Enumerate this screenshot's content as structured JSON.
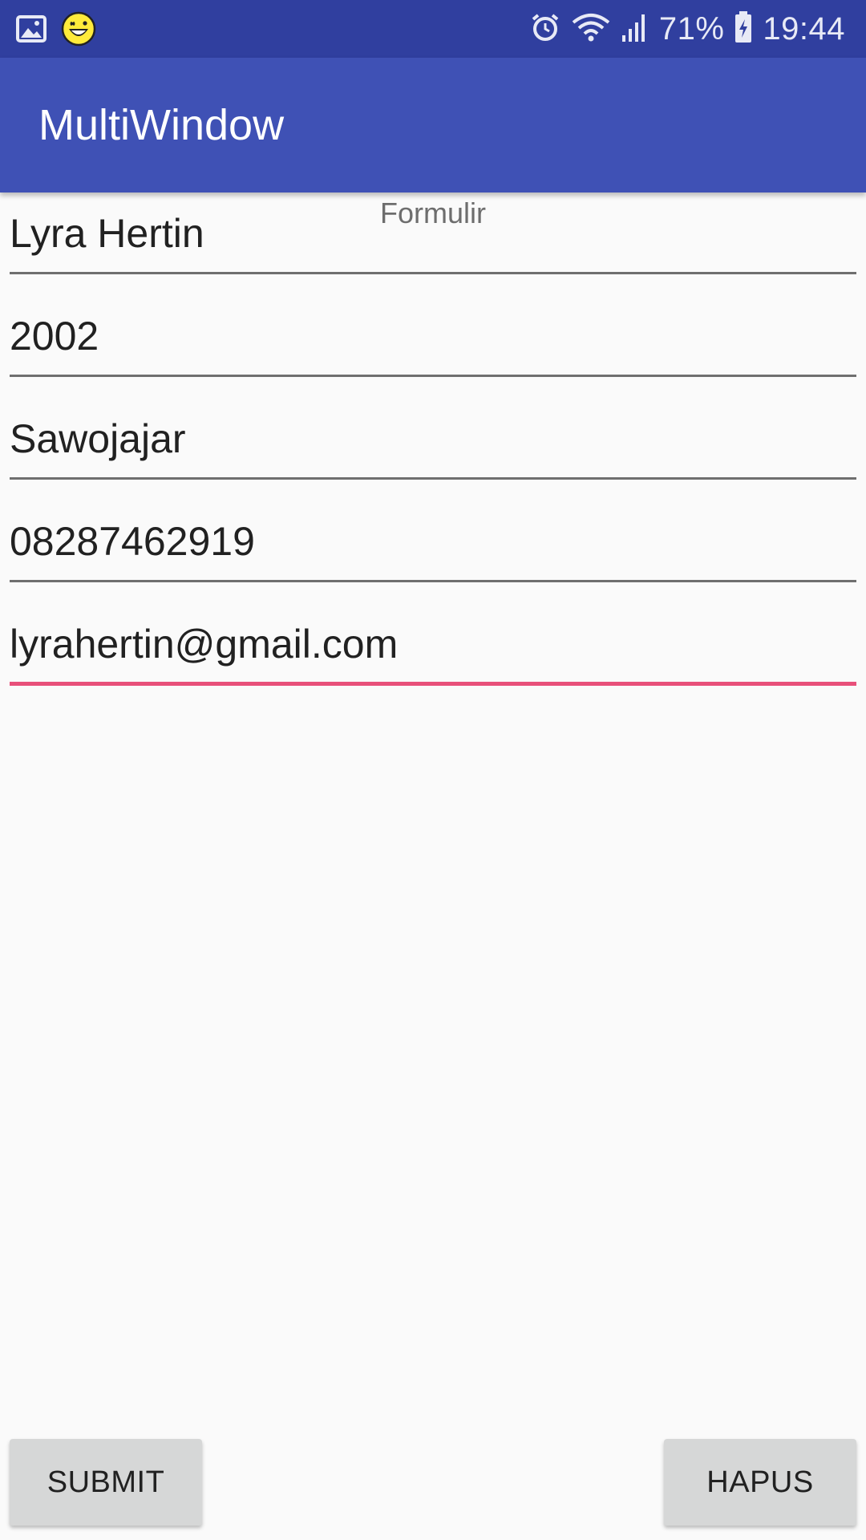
{
  "status_bar": {
    "battery": "71%",
    "time": "19:44",
    "icons": [
      "gallery-icon",
      "emoji-icon",
      "alarm-icon",
      "wifi-icon",
      "signal-icon",
      "battery-charging-icon"
    ],
    "emoji_color": "#ffeb3b"
  },
  "app_bar": {
    "title": "MultiWindow",
    "color": "#3f51b5"
  },
  "form": {
    "caption": "Formulir",
    "fields": [
      {
        "value": "Lyra Hertin"
      },
      {
        "value": "2002"
      },
      {
        "value": "Sawojajar"
      },
      {
        "value": "08287462919"
      },
      {
        "value": "lyrahertin@gmail.com",
        "focused": true
      }
    ],
    "focus_color": "#e8507a"
  },
  "buttons": {
    "submit": "SUBMIT",
    "hapus": "HAPUS"
  }
}
